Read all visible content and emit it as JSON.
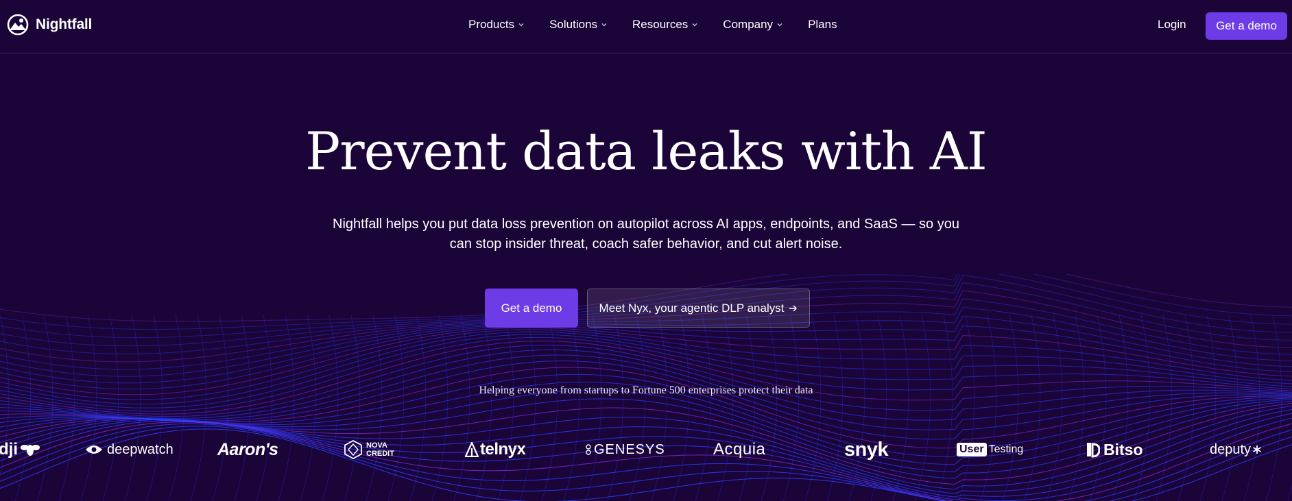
{
  "header": {
    "brand": "Nightfall",
    "nav": [
      {
        "label": "Products",
        "has_dropdown": true
      },
      {
        "label": "Solutions",
        "has_dropdown": true
      },
      {
        "label": "Resources",
        "has_dropdown": true
      },
      {
        "label": "Company",
        "has_dropdown": true
      },
      {
        "label": "Plans",
        "has_dropdown": false
      }
    ],
    "login_label": "Login",
    "demo_label": "Get a demo"
  },
  "hero": {
    "title": "Prevent data leaks with AI",
    "subtitle": "Nightfall helps you put data loss prevention on autopilot across AI apps, endpoints, and SaaS — so you can stop insider threat, coach safer behavior, and cut alert noise.",
    "primary_cta": "Get a demo",
    "secondary_cta": "Meet Nyx, your agentic DLP analyst"
  },
  "customers": {
    "tagline": "Helping everyone from startups to Fortune 500 enterprises protect their data",
    "logos": {
      "dji": "dji",
      "deepwatch": "deepwatch",
      "aarons": "Aaron's",
      "nova_line1": "NOVA",
      "nova_line2": "CREDIT",
      "telnyx": "telnyx",
      "genesys": "GENESYS",
      "acquia": "Acquia",
      "snyk": "snyk",
      "usertesting_box": "User",
      "usertesting_rest": "Testing",
      "bitso": "Bitso",
      "deputy": "deputy"
    }
  },
  "colors": {
    "background": "#1b0438",
    "accent": "#6e3ce6",
    "wave_blue": "#2a3cff",
    "wave_purple": "#7a2ad6"
  },
  "icons": [
    "nightfall-logo-icon",
    "chevron-down-icon",
    "arrow-right-icon",
    "eye-icon",
    "nova-hexagon-icon",
    "telnyx-mark-icon",
    "bitso-mark-icon"
  ]
}
